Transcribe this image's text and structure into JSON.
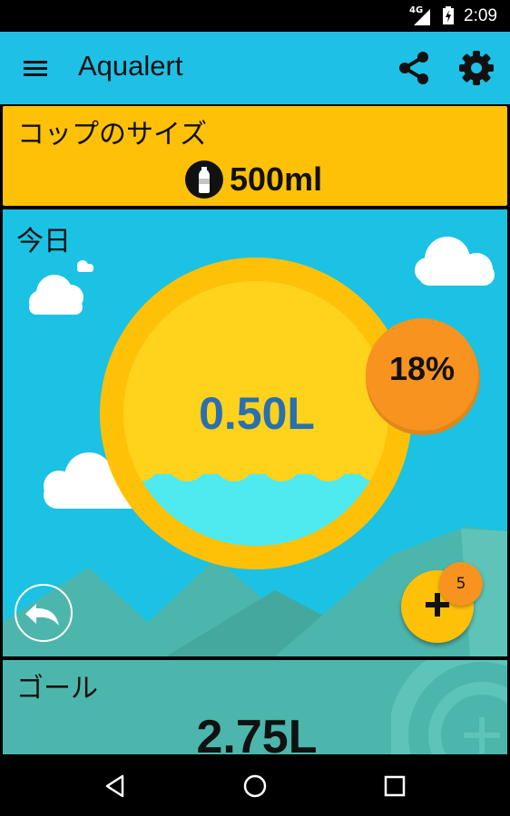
{
  "status_bar": {
    "network": "4G",
    "time": "2:09"
  },
  "app_bar": {
    "title": "Aqualert",
    "icons": [
      "menu-icon",
      "share-icon",
      "gear-icon"
    ]
  },
  "cup_size": {
    "label": "コップのサイズ",
    "value": "500ml",
    "icon": "bottle-icon"
  },
  "today": {
    "label": "今日",
    "total": "0.50L",
    "percent": "18%",
    "fill_percent": 18,
    "add_count": "5",
    "icons": [
      "undo-icon",
      "plus-icon"
    ]
  },
  "goal": {
    "label": "ゴール",
    "value": "2.75L",
    "icon": "add-goal-icon"
  },
  "colors": {
    "app_bar": "#1ec0e6",
    "cup_card": "#ffc107",
    "sky": "#1bc2e3",
    "sun": "#ffc107",
    "water": "#4eeaf0",
    "percent_badge": "#f7931e",
    "mountains": "#4db6ac",
    "goal_card": "#4db6ac",
    "total_text": "#2a6fb0"
  },
  "nav_bar": {
    "icons": [
      "back-icon",
      "home-icon",
      "recents-icon"
    ]
  }
}
